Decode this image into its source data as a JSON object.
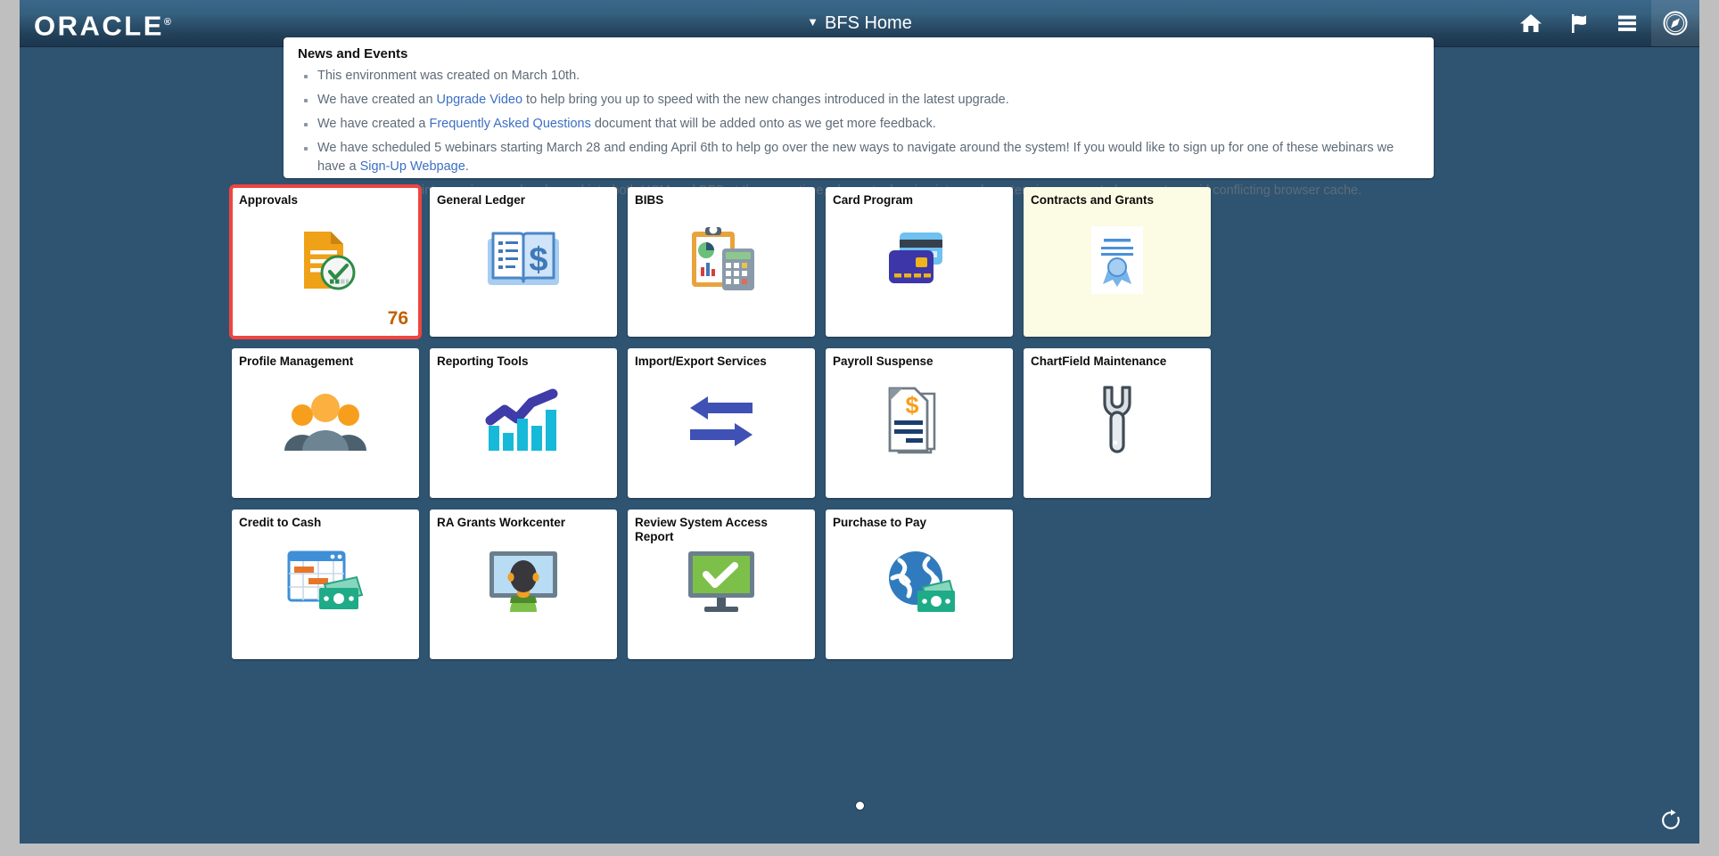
{
  "header": {
    "logo_text": "ORACLE",
    "logo_mark": "®",
    "title": "BFS Home",
    "title_caret": "▼",
    "icons": [
      {
        "name": "home-icon",
        "label": "Home"
      },
      {
        "name": "flag-icon",
        "label": "Notifications"
      },
      {
        "name": "hamburger-menu-icon",
        "label": "Actions"
      },
      {
        "name": "navbar-compass-icon",
        "label": "NavBar"
      }
    ]
  },
  "news": {
    "title": "News and Events",
    "items": [
      {
        "parts": [
          {
            "t": "text",
            "v": "This environment was created on March 10th."
          }
        ]
      },
      {
        "parts": [
          {
            "t": "text",
            "v": "We have created an "
          },
          {
            "t": "link",
            "v": "Upgrade Video"
          },
          {
            "t": "text",
            "v": " to help bring you up to speed with the new changes introduced in the latest upgrade."
          }
        ]
      },
      {
        "parts": [
          {
            "t": "text",
            "v": "We have created a "
          },
          {
            "t": "link",
            "v": "Frequently Asked Questions"
          },
          {
            "t": "text",
            "v": " document that will be added onto as we get more feedback."
          }
        ]
      },
      {
        "parts": [
          {
            "t": "text",
            "v": "We have scheduled 5 webinars starting March 28 and ending April 6th to help go over the new ways to navigate around the system! If you would like to sign up for one of these webinars we have a "
          },
          {
            "t": "link",
            "v": "Sign-Up Webpage"
          },
          {
            "t": "text",
            "v": "."
          }
        ]
      },
      {
        "parts": [
          {
            "t": "text",
            "v": "If you are running into any issues when logged into both HCM and BFS at the same time, please try logging into each system in a seperate browser to avoid conflicting browser cache."
          }
        ]
      }
    ]
  },
  "tiles": [
    [
      {
        "label": "Approvals",
        "icon": "document-approved-icon",
        "badge": "76",
        "selected": true,
        "cream": false
      },
      {
        "label": "General Ledger",
        "icon": "open-book-dollar-icon",
        "badge": "",
        "selected": false,
        "cream": false
      },
      {
        "label": "BIBS",
        "icon": "clipboard-calculator-icon",
        "badge": "",
        "selected": false,
        "cream": false
      },
      {
        "label": "Card Program",
        "icon": "credit-cards-icon",
        "badge": "",
        "selected": false,
        "cream": false
      },
      {
        "label": "Contracts and Grants",
        "icon": "certificate-icon",
        "badge": "",
        "selected": false,
        "cream": true
      }
    ],
    [
      {
        "label": "Profile Management",
        "icon": "people-group-icon",
        "badge": "",
        "selected": false,
        "cream": false
      },
      {
        "label": "Reporting Tools",
        "icon": "bar-chart-trend-icon",
        "badge": "",
        "selected": false,
        "cream": false
      },
      {
        "label": "Import/Export Services",
        "icon": "exchange-arrows-icon",
        "badge": "",
        "selected": false,
        "cream": false
      },
      {
        "label": "Payroll Suspense",
        "icon": "dollar-documents-icon",
        "badge": "",
        "selected": false,
        "cream": false
      },
      {
        "label": "ChartField Maintenance",
        "icon": "wrench-icon",
        "badge": "",
        "selected": false,
        "cream": false
      }
    ],
    [
      {
        "label": "Credit to Cash",
        "icon": "spreadsheet-cash-icon",
        "badge": "",
        "selected": false,
        "cream": false
      },
      {
        "label": "RA Grants Workcenter",
        "icon": "person-monitor-icon",
        "badge": "",
        "selected": false,
        "cream": false
      },
      {
        "label": "Review System Access Report",
        "icon": "monitor-check-icon",
        "badge": "",
        "selected": false,
        "cream": false
      },
      {
        "label": "Purchase to Pay",
        "icon": "globe-cash-icon",
        "badge": "",
        "selected": false,
        "cream": false
      }
    ]
  ],
  "footer": {
    "page_dots": 1,
    "active_dot": 0,
    "refresh_icon": "refresh-icon"
  },
  "colors": {
    "page_background": "#2f5472",
    "header_dark": "#1c3750",
    "selection_outline": "#f0453f",
    "badge_text": "#c06000",
    "link": "#3b6fc4",
    "cream_tile": "#fcfbe3"
  }
}
